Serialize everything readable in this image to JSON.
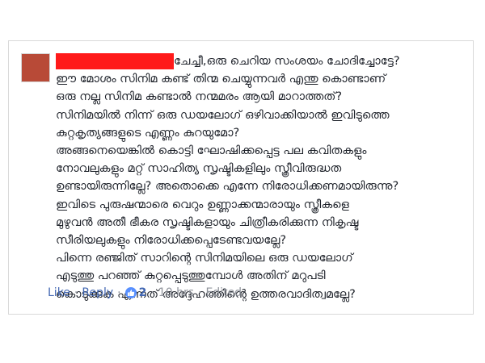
{
  "comment": {
    "first_line": "ചേച്ചീ,ഒരു ചെറിയ സംശയം ചോദിച്ചോട്ടേ?",
    "lines": [
      "ഈ മോശം സിനിമ കണ്ട് തിന്മ ചെയ്യുന്നവർ എന്തു കൊണ്ടാണ്",
      "ഒരു നല്ല സിനിമ കണ്ടാൽ നന്മമരം ആയി മാറാത്തത്?",
      "സിനിമയിൽ നിന്ന് ഒരു ഡയലോഗ് ഒഴിവാക്കിയാൽ ഇവിടുത്തെ",
      "കുറ്റകൃത്യങ്ങളുടെ എണ്ണം കുറയുമോ?",
      "അങ്ങനെയെങ്കിൽ കൊട്ടി ഘോഷിക്കപ്പെട്ട പല കവിതകളും",
      "നോവലുകളും മറ്റ് സാഹിത്യ സൃഷ്ടികളിലും സ്ത്രീവിരുദ്ധത",
      "ഉണ്ടായിരുന്നില്ലേ? അതൊക്കെ എന്നേ നിരോധിക്കണമായിരുന്നു?",
      "ഇവിടെ പുരുഷന്മാരെ വെറും ഉണ്ണാക്കന്മാരായും സ്ത്രീകളെ",
      "മുഴുവൻ അതീ ഭീകര സൃഷ്ടികളായും ചിത്രീകരിക്കുന്ന നികൃഷ്ട",
      "സീരിയലുകളും നിരോധിക്കപ്പെടേണ്ടവയല്ലേ?",
      "പിന്നെ രഞ്ജിത് സാറിന്റെ സിനിമയിലെ ഒരു ഡയലോഗ്",
      "എടുത്തു പറഞ്ഞ് കുറ്റപ്പെടുത്തുമ്പോൾ അതിന് മറുപടി",
      "കൊടുക്കുക എന്നത് അദ്ദേഹത്തിന്റെ ഉത്തരവാദിത്വമല്ലേ?"
    ]
  },
  "actions": {
    "like": "Like",
    "reply": "Reply",
    "like_count": "2",
    "timestamp": "10 hrs",
    "edited": "Edited",
    "separator": "·"
  },
  "colors": {
    "redaction": "#ff1a1a",
    "link": "#4267b2",
    "meta": "#90949c",
    "like_icon": "#5890ff"
  },
  "icons": {
    "like_badge": "thumbs-up-icon"
  }
}
